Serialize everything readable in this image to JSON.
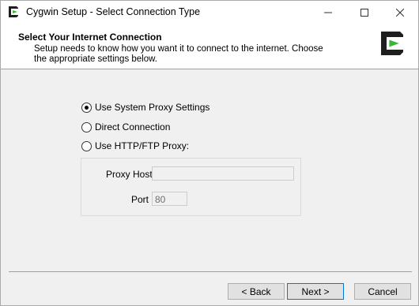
{
  "window": {
    "title": "Cygwin Setup - Select Connection Type",
    "minimize_icon": "minimize-icon",
    "maximize_icon": "maximize-icon",
    "close_icon": "close-icon"
  },
  "header": {
    "title": "Select Your Internet Connection",
    "description": "Setup needs to know how you want it to connect to the internet.  Choose the appropriate settings below.",
    "logo_icon": "cygwin-logo-icon"
  },
  "connection_options": [
    {
      "label": "Use System Proxy Settings",
      "selected": true
    },
    {
      "label": "Direct Connection",
      "selected": false
    },
    {
      "label": "Use HTTP/FTP Proxy:",
      "selected": false
    }
  ],
  "proxy": {
    "host_label": "Proxy Host",
    "host_value": "",
    "port_label": "Port",
    "port_value": "80"
  },
  "buttons": {
    "back": "< Back",
    "next": "Next >",
    "cancel": "Cancel"
  },
  "colors": {
    "accent": "#0078d7",
    "logo_green": "#3cb43c",
    "logo_dark": "#1e1e1e"
  }
}
